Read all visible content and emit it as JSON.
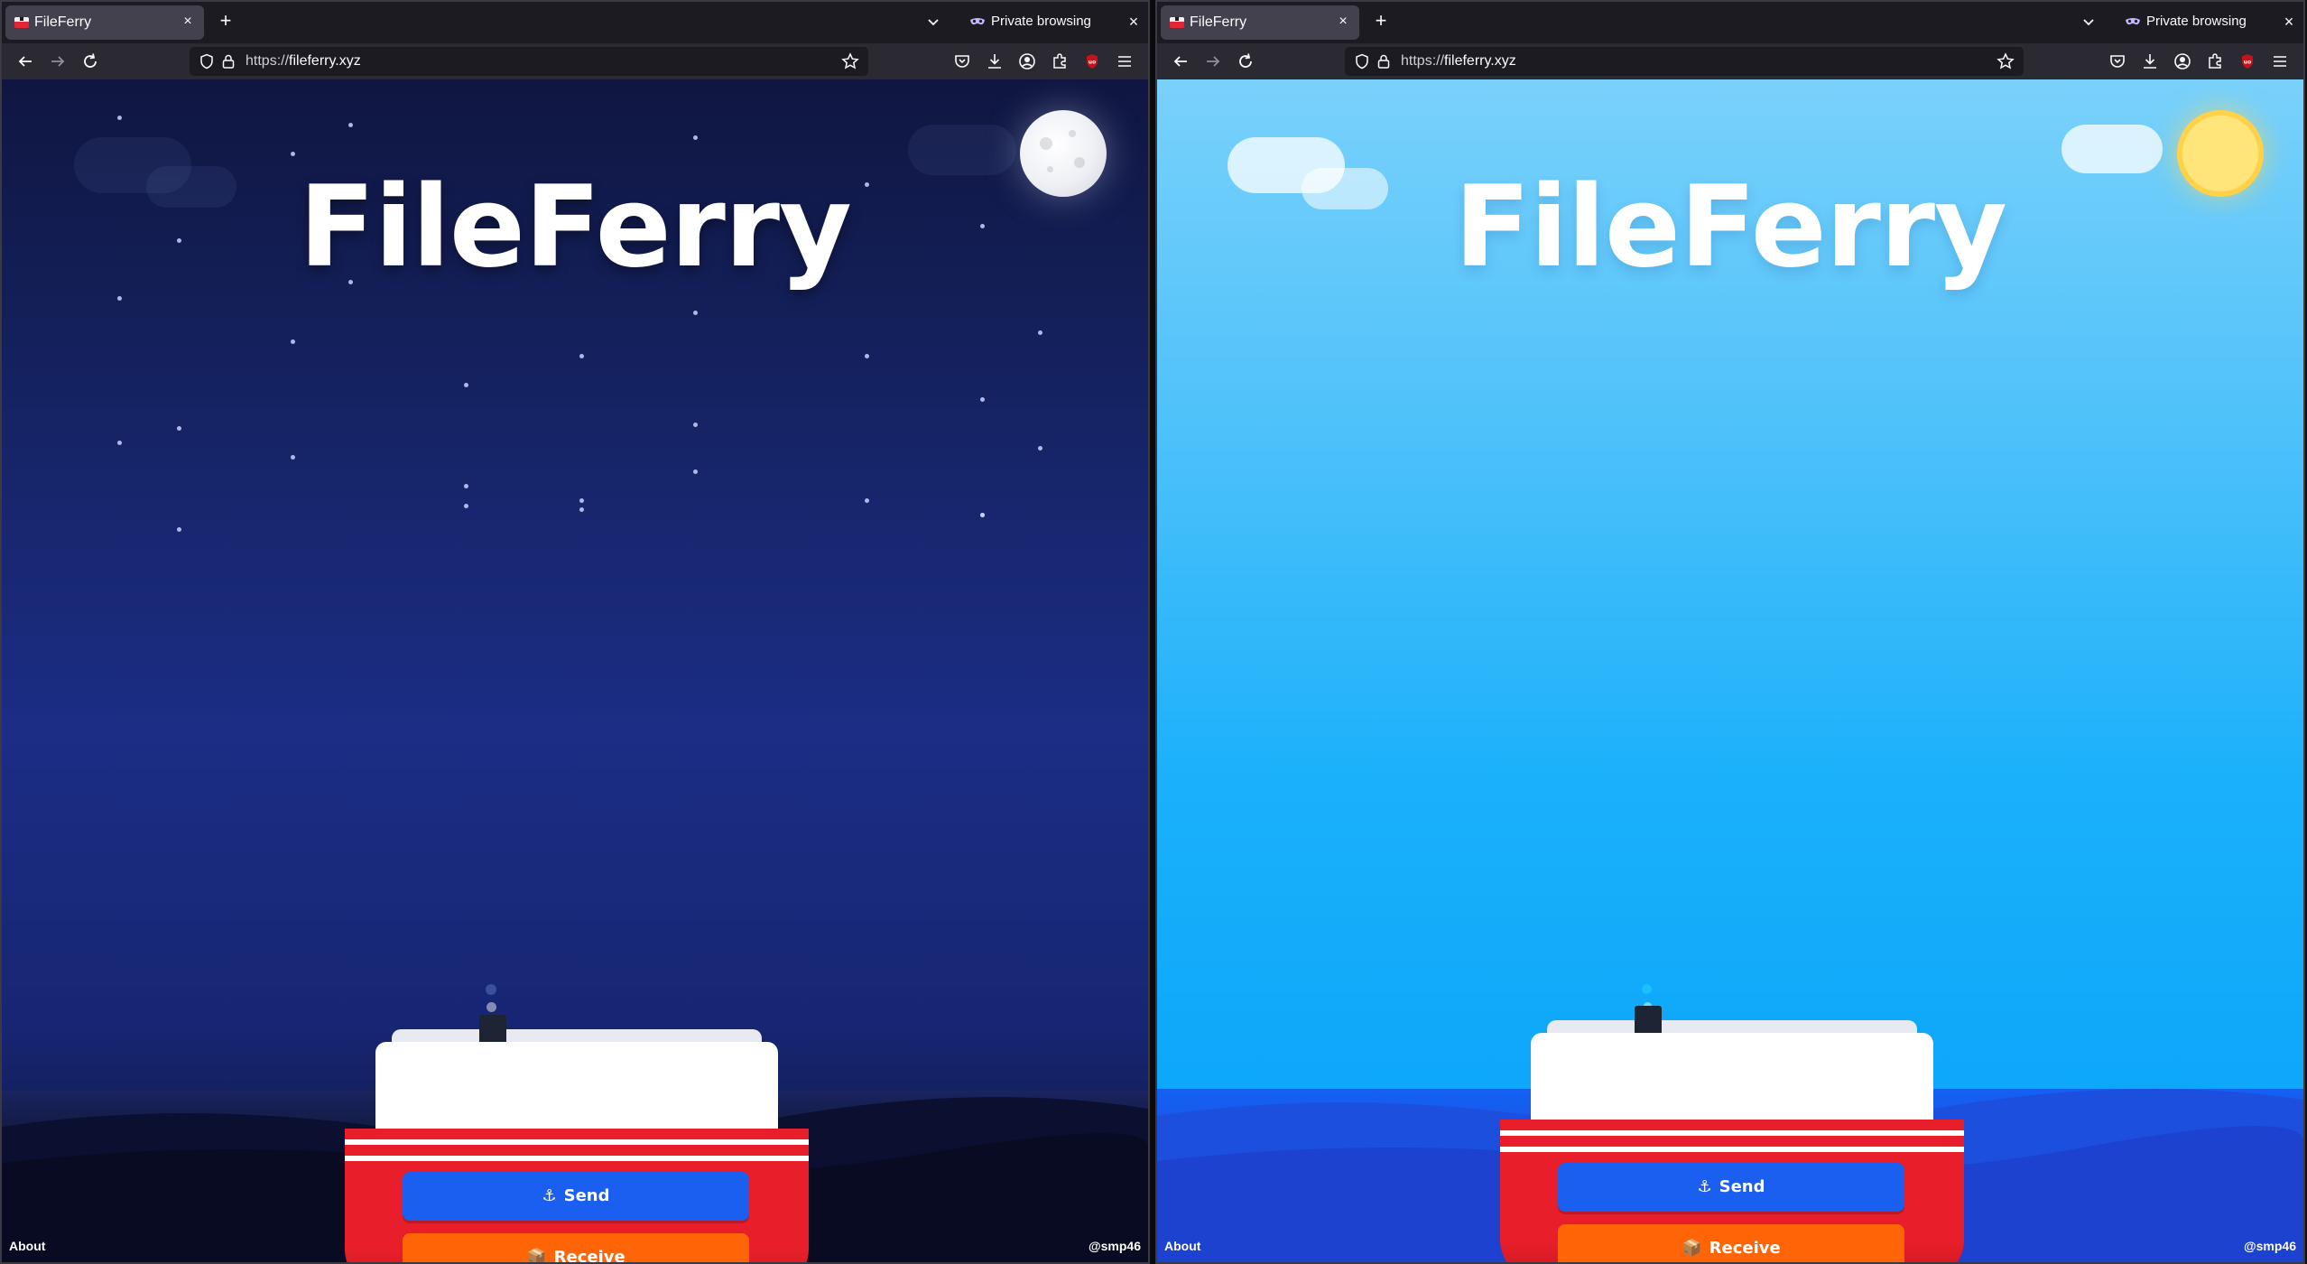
{
  "windows": [
    {
      "theme": "night",
      "tab": {
        "title": "FileFerry",
        "close": "×"
      },
      "newtab": "+",
      "private_label": "Private browsing",
      "window_close": "×",
      "url": {
        "scheme": "https://",
        "host": "fileferry.xyz"
      },
      "page": {
        "title": "FileFerry",
        "send_icon": "⚓",
        "send_label": "Send",
        "receive_icon": "📦",
        "receive_label": "Receive",
        "footer_left": "About",
        "footer_right": "@smp46",
        "celestial": "moon-icon"
      }
    },
    {
      "theme": "day",
      "tab": {
        "title": "FileFerry",
        "close": "×"
      },
      "newtab": "+",
      "private_label": "Private browsing",
      "window_close": "×",
      "url": {
        "scheme": "https://",
        "host": "fileferry.xyz"
      },
      "page": {
        "title": "FileFerry",
        "send_icon": "⚓",
        "send_label": "Send",
        "receive_icon": "📦",
        "receive_label": "Receive",
        "footer_left": "About",
        "footer_right": "@smp46",
        "celestial": "sun-icon"
      }
    }
  ],
  "colors": {
    "hull": "#e81f2a",
    "send_button": "#1a5ff0",
    "receive_button": "#ff6506",
    "night_sky": "#162466",
    "day_sky": "#1ab0fb"
  }
}
